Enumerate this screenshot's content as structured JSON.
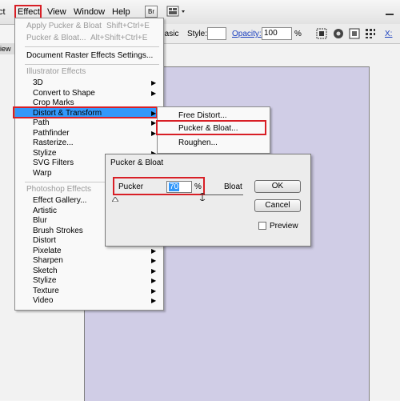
{
  "menubar": {
    "items": [
      "ct",
      "Effect",
      "View",
      "Window",
      "Help"
    ],
    "br_label": "Br"
  },
  "controlbar": {
    "basic_value": "Basic",
    "style_label": "Style:",
    "opacity_label": "Opacity:",
    "opacity_value": "100",
    "percent": "%",
    "x_label": "X:"
  },
  "doc_tab": "iew",
  "effect_menu": {
    "apply_item": {
      "label": "Apply Pucker & Bloat",
      "shortcut": "Shift+Ctrl+E"
    },
    "last_item": {
      "label": "Pucker & Bloat...",
      "shortcut": "Alt+Shift+Ctrl+E"
    },
    "doc_settings": "Document Raster Effects Settings...",
    "illustrator_header": "Illustrator Effects",
    "illustrator_items": [
      {
        "label": "3D",
        "submenu": true
      },
      {
        "label": "Convert to Shape",
        "submenu": true
      },
      {
        "label": "Crop Marks",
        "submenu": false
      },
      {
        "label": "Distort & Transform",
        "submenu": true
      },
      {
        "label": "Path",
        "submenu": true
      },
      {
        "label": "Pathfinder",
        "submenu": true
      },
      {
        "label": "Rasterize...",
        "submenu": false
      },
      {
        "label": "Stylize",
        "submenu": true
      },
      {
        "label": "SVG Filters",
        "submenu": true
      },
      {
        "label": "Warp",
        "submenu": true
      }
    ],
    "photoshop_header": "Photoshop Effects",
    "photoshop_items": [
      {
        "label": "Effect Gallery...",
        "submenu": false
      },
      {
        "label": "Artistic",
        "submenu": true
      },
      {
        "label": "Blur",
        "submenu": true
      },
      {
        "label": "Brush Strokes",
        "submenu": true
      },
      {
        "label": "Distort",
        "submenu": true
      },
      {
        "label": "Pixelate",
        "submenu": true
      },
      {
        "label": "Sharpen",
        "submenu": true
      },
      {
        "label": "Sketch",
        "submenu": true
      },
      {
        "label": "Stylize",
        "submenu": true
      },
      {
        "label": "Texture",
        "submenu": true
      },
      {
        "label": "Video",
        "submenu": true
      }
    ]
  },
  "submenu": {
    "items": [
      "Free Distort...",
      "Pucker & Bloat...",
      "Roughen..."
    ]
  },
  "dialog": {
    "title": "Pucker & Bloat",
    "pucker_label": "Pucker",
    "value": "70",
    "percent": "%",
    "bloat_label": "Bloat",
    "slider_level_percent": 0,
    "ok_label": "OK",
    "cancel_label": "Cancel",
    "preview_label": "Preview",
    "preview_checked": false
  },
  "colors": {
    "highlight": "#3398fa",
    "annotation_red": "#d81f26",
    "artboard": "#d0cde6"
  }
}
